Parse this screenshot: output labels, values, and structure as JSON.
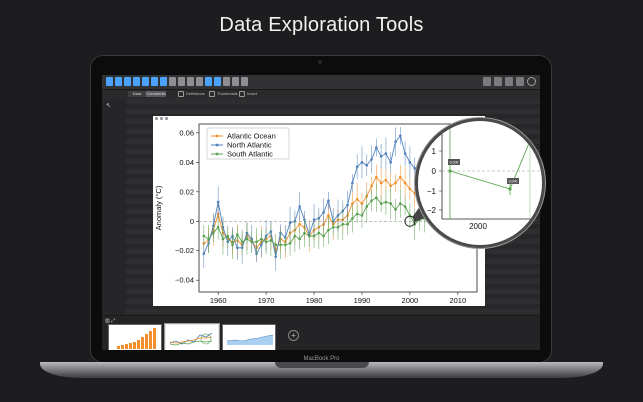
{
  "headline": "Data Exploration Tools",
  "device_label": "MacBook Pro",
  "toolbar": {
    "left_icons": [
      {
        "name": "line-chart-icon",
        "color": "#4aa3ff"
      },
      {
        "name": "scatter-icon",
        "color": "#4aa3ff"
      },
      {
        "name": "bar-chart-icon",
        "color": "#4aa3ff"
      },
      {
        "name": "histogram-icon",
        "color": "#4aa3ff"
      },
      {
        "name": "globe-icon",
        "color": "#4aa3ff"
      },
      {
        "name": "shapes-icon",
        "color": "#4aa3ff"
      },
      {
        "name": "crosshair-icon",
        "color": "#4aa3ff"
      },
      {
        "name": "area-chart-icon",
        "color": "#8d8d92"
      },
      {
        "name": "peak-icon",
        "color": "#8d8d92"
      },
      {
        "name": "curve-icon",
        "color": "#8d8d92"
      },
      {
        "name": "wave-icon",
        "color": "#8d8d92"
      },
      {
        "name": "box-icon",
        "color": "#4aa3ff"
      },
      {
        "name": "columns-icon",
        "color": "#4aa3ff"
      },
      {
        "name": "bars-icon",
        "color": "#8d8d92"
      },
      {
        "name": "grid-icon",
        "color": "#8d8d92"
      },
      {
        "name": "dots-icon",
        "color": "#8d8d92"
      }
    ],
    "right_icons": [
      "layers-icon",
      "table-icon",
      "list-icon",
      "document-icon",
      "info-icon"
    ]
  },
  "tabbar": {
    "segments": [
      {
        "label": "Data",
        "active": false
      },
      {
        "label": "Comments",
        "active": true
      }
    ],
    "options": [
      "Definitions",
      "Thumbnails",
      "Insert"
    ]
  },
  "chart_data": {
    "type": "line",
    "ylabel": "Anomaly (°C)",
    "xlabel": "",
    "xlim": [
      1956,
      2014
    ],
    "ylim": [
      -0.048,
      0.066
    ],
    "xticks": [
      1960,
      1970,
      1980,
      1990,
      2000,
      2010
    ],
    "yticks": [
      -0.04,
      -0.02,
      0,
      0.02,
      0.04,
      0.06
    ],
    "ytick_labels": [
      "−0.04",
      "−0.02",
      "0",
      "0.02",
      "0.04",
      "0.06"
    ],
    "legend_position": "top-left",
    "x": [
      1957,
      1958,
      1959,
      1960,
      1961,
      1962,
      1963,
      1964,
      1965,
      1966,
      1967,
      1968,
      1969,
      1970,
      1971,
      1972,
      1973,
      1974,
      1975,
      1976,
      1977,
      1978,
      1979,
      1980,
      1981,
      1982,
      1983,
      1984,
      1985,
      1986,
      1987,
      1988,
      1989,
      1990,
      1991,
      1992,
      1993,
      1994,
      1995,
      1996,
      1997,
      1998,
      1999,
      2000,
      2001,
      2002,
      2003,
      2004,
      2005,
      2006,
      2007,
      2008,
      2009,
      2010,
      2011,
      2012
    ],
    "series": [
      {
        "name": "Atlantic Ocean",
        "color": "#f28e2b",
        "values": [
          -0.015,
          -0.013,
          -0.006,
          0.005,
          -0.008,
          -0.012,
          -0.014,
          -0.013,
          -0.016,
          -0.01,
          -0.013,
          -0.018,
          -0.014,
          -0.012,
          -0.01,
          -0.02,
          -0.012,
          -0.014,
          -0.008,
          -0.006,
          -0.002,
          -0.004,
          -0.01,
          -0.006,
          -0.004,
          -0.002,
          0.004,
          -0.002,
          0.001,
          0.001,
          0.004,
          0.012,
          0.015,
          0.012,
          0.017,
          0.024,
          0.03,
          0.026,
          0.028,
          0.024,
          0.026,
          0.03,
          0.026,
          0.022,
          0.019,
          0.018,
          0.02,
          0.024,
          0.022,
          0.016,
          0.014,
          0.01,
          0.008,
          0.006,
          0.004,
          0.003
        ]
      },
      {
        "name": "North Atlantic",
        "color": "#4f81bd",
        "values": [
          -0.022,
          -0.015,
          -0.003,
          0.013,
          -0.004,
          -0.014,
          -0.01,
          -0.018,
          -0.018,
          -0.008,
          -0.012,
          -0.022,
          -0.016,
          -0.01,
          -0.007,
          -0.024,
          -0.008,
          -0.011,
          -0.001,
          0.0,
          0.01,
          0.001,
          -0.009,
          0.001,
          0.002,
          0.006,
          0.014,
          0.0,
          0.004,
          0.007,
          0.011,
          0.026,
          0.037,
          0.04,
          0.038,
          0.042,
          0.05,
          0.044,
          0.046,
          0.04,
          0.054,
          0.058,
          0.046,
          0.04,
          0.036,
          0.03,
          0.034,
          0.036,
          0.04,
          0.026,
          0.022,
          0.014,
          0.016,
          0.012,
          0.008,
          0.006
        ]
      },
      {
        "name": "South Atlantic",
        "color": "#59a14f",
        "values": [
          -0.01,
          -0.012,
          -0.008,
          -0.004,
          -0.012,
          -0.01,
          -0.016,
          -0.009,
          -0.014,
          -0.012,
          -0.014,
          -0.014,
          -0.012,
          -0.014,
          -0.013,
          -0.016,
          -0.016,
          -0.016,
          -0.015,
          -0.01,
          -0.012,
          -0.008,
          -0.01,
          -0.01,
          -0.008,
          -0.01,
          -0.006,
          -0.004,
          -0.004,
          -0.002,
          -0.002,
          0.002,
          0.005,
          0.004,
          0.01,
          0.014,
          0.016,
          0.012,
          0.013,
          0.012,
          0.008,
          0.012,
          0.01,
          0.004,
          -0.002,
          0.001,
          0.002,
          0.008,
          0.006,
          0.005,
          0.004,
          0.002,
          0.001,
          0.002,
          0.0,
          -0.001
        ]
      }
    ],
    "inset": {
      "xticks": [
        2000
      ],
      "yticks": [
        1,
        0,
        -1,
        -2
      ],
      "ytick_labels": [
        "1",
        "0",
        "−1",
        "−2"
      ],
      "labels": [
        "0.000",
        "0.000"
      ]
    }
  },
  "thumbnails": [
    {
      "name": "bar-thumbnail",
      "selected": false
    },
    {
      "name": "line-thumbnail",
      "selected": true
    },
    {
      "name": "area-thumbnail",
      "selected": false
    }
  ]
}
